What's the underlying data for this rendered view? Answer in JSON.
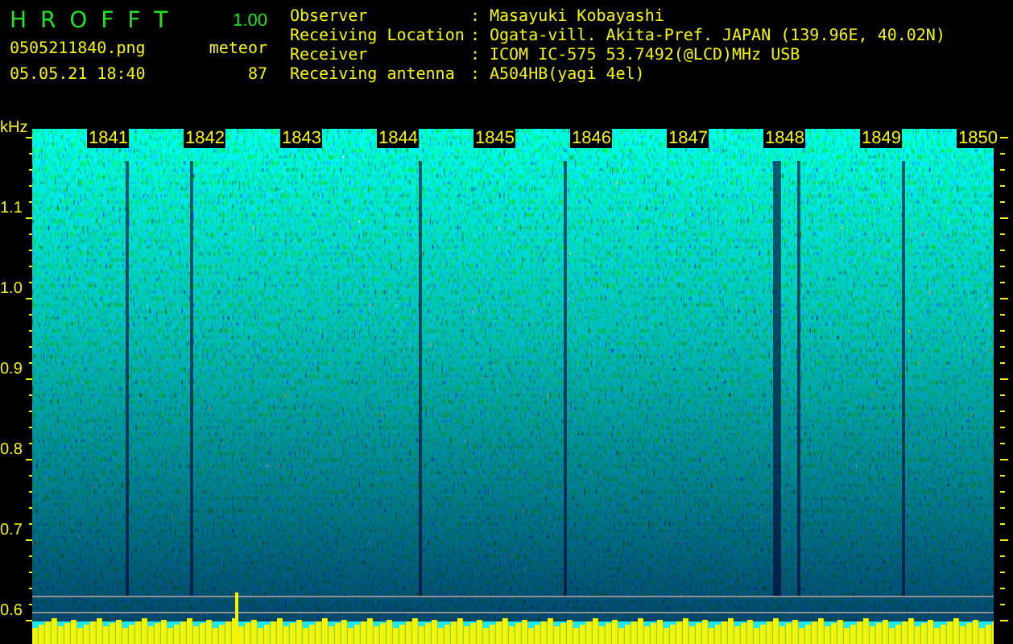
{
  "app": {
    "title": "H R O F F T",
    "version": "1.00"
  },
  "file": {
    "name": "0505211840.png",
    "datetime": "05.05.21 18:40"
  },
  "detection": {
    "label": "meteor",
    "count": "87"
  },
  "info": [
    {
      "label": "Observer",
      "separator": ":",
      "value": "Masayuki Kobayashi"
    },
    {
      "label": "Receiving Location",
      "separator": ":",
      "value": "Ogata-vill. Akita-Pref. JAPAN (139.96E, 40.02N)"
    },
    {
      "label": "Receiver",
      "separator": ":",
      "value": "ICOM IC-575 53.7492(@LCD)MHz USB"
    },
    {
      "label": "Receiving antenna",
      "separator": ":",
      "value": "A504HB(yagi 4el)"
    }
  ],
  "spectrogram": {
    "unit": "kHz",
    "y_labels": [
      "1.1",
      "1.0",
      "0.9",
      "0.8",
      "0.7",
      "0.6"
    ],
    "time_labels": [
      "1841",
      "1842",
      "1843",
      "1844",
      "1845",
      "1846",
      "1847",
      "1848",
      "1849",
      "1850"
    ]
  }
}
